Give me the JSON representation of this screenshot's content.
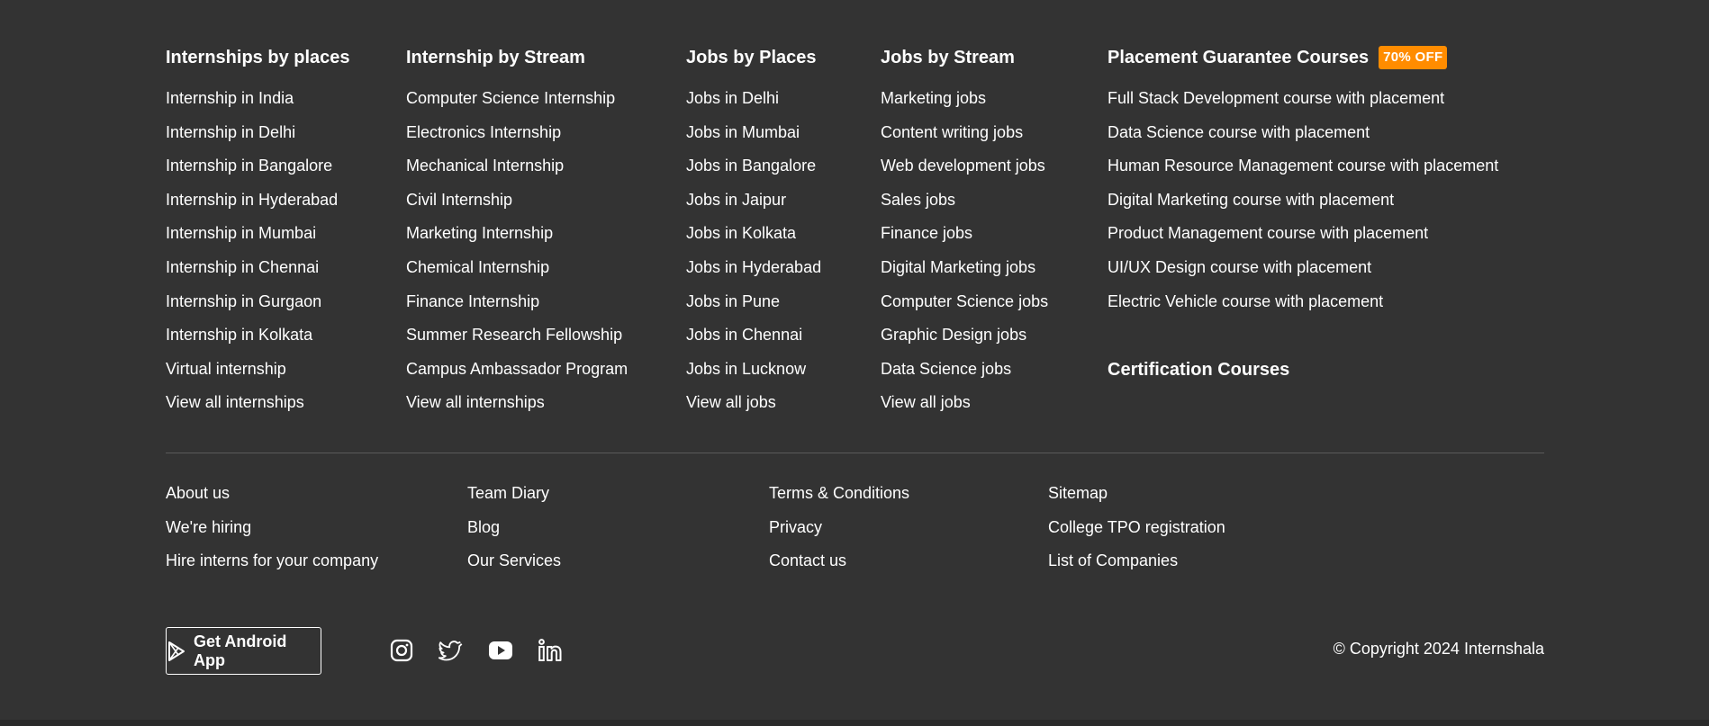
{
  "columns": {
    "c1": {
      "title": "Internships by places",
      "items": [
        "Internship in India",
        "Internship in Delhi",
        "Internship in Bangalore",
        "Internship in Hyderabad",
        "Internship in Mumbai",
        "Internship in Chennai",
        "Internship in Gurgaon",
        "Internship in Kolkata",
        "Virtual internship",
        "View all internships"
      ]
    },
    "c2": {
      "title": "Internship by Stream",
      "items": [
        "Computer Science Internship",
        "Electronics Internship",
        "Mechanical Internship",
        "Civil Internship",
        "Marketing Internship",
        "Chemical Internship",
        "Finance Internship",
        "Summer Research Fellowship",
        "Campus Ambassador Program",
        "View all internships"
      ]
    },
    "c3": {
      "title": "Jobs by Places",
      "items": [
        "Jobs in Delhi",
        "Jobs in Mumbai",
        "Jobs in Bangalore",
        "Jobs in Jaipur",
        "Jobs in Kolkata",
        "Jobs in Hyderabad",
        "Jobs in Pune",
        "Jobs in Chennai",
        "Jobs in Lucknow",
        "View all jobs"
      ]
    },
    "c4": {
      "title": "Jobs by Stream",
      "items": [
        "Marketing jobs",
        "Content writing jobs",
        "Web development jobs",
        "Sales jobs",
        "Finance jobs",
        "Digital Marketing jobs",
        "Computer Science jobs",
        "Graphic Design jobs",
        "Data Science jobs",
        "View all jobs"
      ]
    },
    "c5": {
      "title": "Placement Guarantee Courses",
      "badge": "70% OFF",
      "items": [
        "Full Stack Development course with placement",
        "Data Science course with placement",
        "Human Resource Management course with placement",
        "Digital Marketing course with placement",
        "Product Management course with placement",
        "UI/UX Design course with placement",
        "Electric Vehicle course with placement"
      ]
    }
  },
  "certification_title": "Certification Courses",
  "bottom_links": {
    "b1": [
      "About us",
      "We're hiring",
      "Hire interns for your company"
    ],
    "b2": [
      "Team Diary",
      "Blog",
      "Our Services"
    ],
    "b3": [
      "Terms & Conditions",
      "Privacy",
      "Contact us"
    ],
    "b4": [
      "Sitemap",
      "College TPO registration",
      "List of Companies"
    ]
  },
  "android_label": "Get Android App",
  "social_icons": [
    "instagram-icon",
    "twitter-icon",
    "youtube-icon",
    "linkedin-icon"
  ],
  "copyright": "© Copyright 2024 Internshala",
  "colors": {
    "background": "#333333",
    "badge": "#ff8c00",
    "text": "#ffffff"
  }
}
